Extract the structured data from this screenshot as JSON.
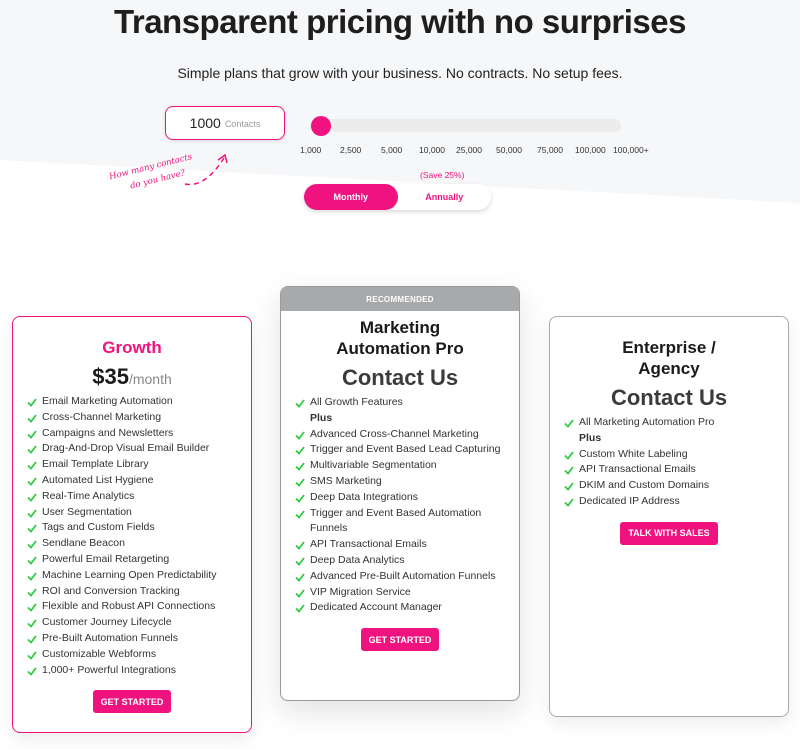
{
  "header": {
    "title": "Transparent pricing with no surprises",
    "subtitle": "Simple plans that grow with your business. No contracts. No setup fees."
  },
  "contacts": {
    "value": "1000",
    "unit": "Contacts",
    "hint_line1": "How many contacts",
    "hint_line2": "do you have?"
  },
  "slider": {
    "selected_index": 0,
    "ticks": [
      "1,000",
      "2,500",
      "5,000",
      "10,000",
      "25,000",
      "50,000",
      "75,000",
      "100,000",
      "100,000+"
    ]
  },
  "billing": {
    "save_note": "(Save 25%)",
    "options": [
      "Monthly",
      "Annually"
    ],
    "selected": "Monthly"
  },
  "colors": {
    "accent": "#f0127f",
    "check": "#2ecc40",
    "recommended_banner": "#a7a9aa"
  },
  "plans": [
    {
      "name": "Growth",
      "price": "$35",
      "period": "/month",
      "features": [
        "Email Marketing Automation",
        "Cross-Channel Marketing",
        "Campaigns and Newsletters",
        "Drag-And-Drop Visual Email Builder",
        "Email Template Library",
        "Automated List Hygiene",
        "Real-Time Analytics",
        "User Segmentation",
        "Tags and Custom Fields",
        "Sendlane Beacon",
        "Powerful Email Retargeting",
        "Machine Learning Open Predictability",
        "ROI and Conversion Tracking",
        "Flexible and Robust API Connections",
        "Customer Journey Lifecycle",
        "Pre-Built Automation Funnels",
        "Customizable Webforms",
        "1,000+ Powerful Integrations"
      ],
      "cta": "GET STARTED"
    },
    {
      "badge": "RECOMMENDED",
      "name_line1": "Marketing",
      "name_line2": "Automation Pro",
      "price_text": "Contact Us",
      "first_feature": "All Growth Features",
      "plus_label": "Plus",
      "features": [
        "Advanced Cross-Channel Marketing",
        "Trigger and Event Based Lead Capturing",
        "Multivariable Segmentation",
        "SMS Marketing",
        "Deep Data Integrations",
        "Trigger and Event Based Automation Funnels",
        "API Transactional Emails",
        "Deep Data Analytics",
        "Advanced Pre-Built Automation Funnels",
        "VIP Migration Service",
        "Dedicated Account Manager"
      ],
      "cta": "GET STARTED"
    },
    {
      "name_line1": "Enterprise /",
      "name_line2": "Agency",
      "price_text": "Contact Us",
      "first_feature": "All Marketing Automation Pro",
      "plus_label": "Plus",
      "features": [
        "Custom White Labeling",
        "API Transactional Emails",
        "DKIM and Custom Domains",
        "Dedicated IP Address"
      ],
      "cta": "TALK WITH SALES"
    }
  ]
}
